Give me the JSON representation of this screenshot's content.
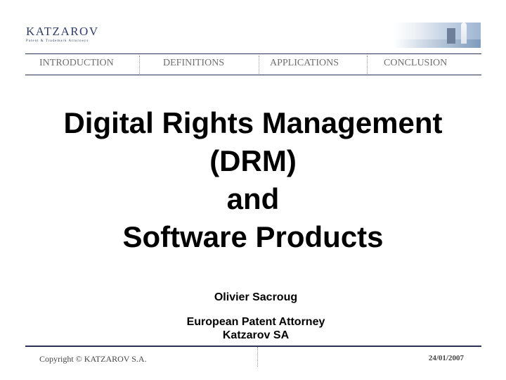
{
  "header": {
    "logo_name": "KATZAROV",
    "logo_tagline": "Patent & Trademark Attorneys"
  },
  "nav": {
    "items": [
      {
        "label": "INTRODUCTION"
      },
      {
        "label": "DEFINITIONS"
      },
      {
        "label": "APPLICATIONS"
      },
      {
        "label": "CONCLUSION"
      }
    ]
  },
  "slide": {
    "title_lines": [
      "Digital Rights Management",
      "(DRM)",
      "and",
      "Software Products"
    ],
    "author": "Olivier Sacroug",
    "role": "European Patent Attorney",
    "company": "Katzarov SA"
  },
  "footer": {
    "copyright": "Copyright © KATZAROV S.A.",
    "date": "24/01/2007"
  },
  "colors": {
    "rule": "#2b3355",
    "nav_text": "#6f6f6f",
    "logo": "#2f3d66"
  }
}
